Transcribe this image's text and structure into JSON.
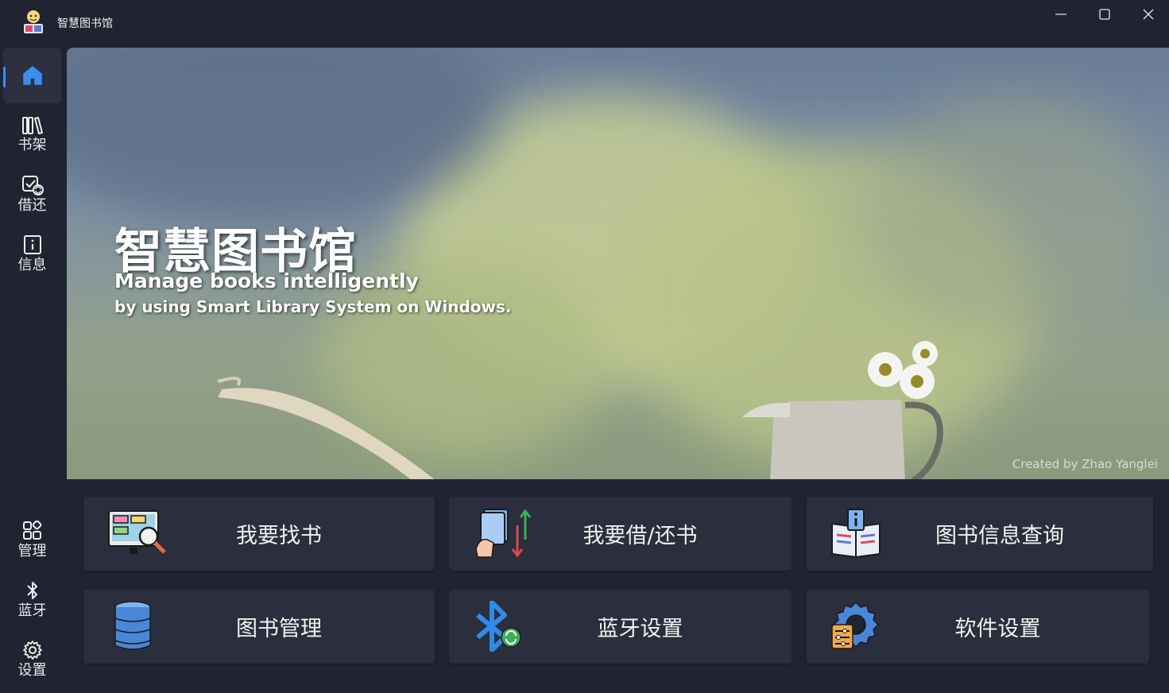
{
  "window": {
    "title": "智慧图书馆"
  },
  "sidebar": {
    "items": [
      {
        "label": "",
        "icon": "home-icon",
        "active": true
      },
      {
        "label": "书架",
        "icon": "bookshelf-icon"
      },
      {
        "label": "借还",
        "icon": "borrow-return-icon"
      },
      {
        "label": "信息",
        "icon": "info-icon"
      }
    ],
    "bottom_items": [
      {
        "label": "管理",
        "icon": "manage-icon"
      },
      {
        "label": "蓝牙",
        "icon": "bluetooth-icon"
      },
      {
        "label": "设置",
        "icon": "gear-icon"
      }
    ]
  },
  "banner": {
    "title": "智慧图书馆",
    "subtitle_line1": "Manage books intelligently",
    "subtitle_line2": "by using Smart Library System on Windows.",
    "credit": "Created by Zhao Yanglei"
  },
  "tiles": [
    {
      "label": "我要找书",
      "icon": "search-book-icon"
    },
    {
      "label": "我要借/还书",
      "icon": "borrow-book-icon"
    },
    {
      "label": "图书信息查询",
      "icon": "book-info-icon"
    },
    {
      "label": "图书管理",
      "icon": "database-icon"
    },
    {
      "label": "蓝牙设置",
      "icon": "bluetooth-settings-icon"
    },
    {
      "label": "软件设置",
      "icon": "software-settings-icon"
    }
  ],
  "colors": {
    "background": "#202331",
    "tile": "#2b2e3c",
    "accent": "#3a8ef0"
  }
}
